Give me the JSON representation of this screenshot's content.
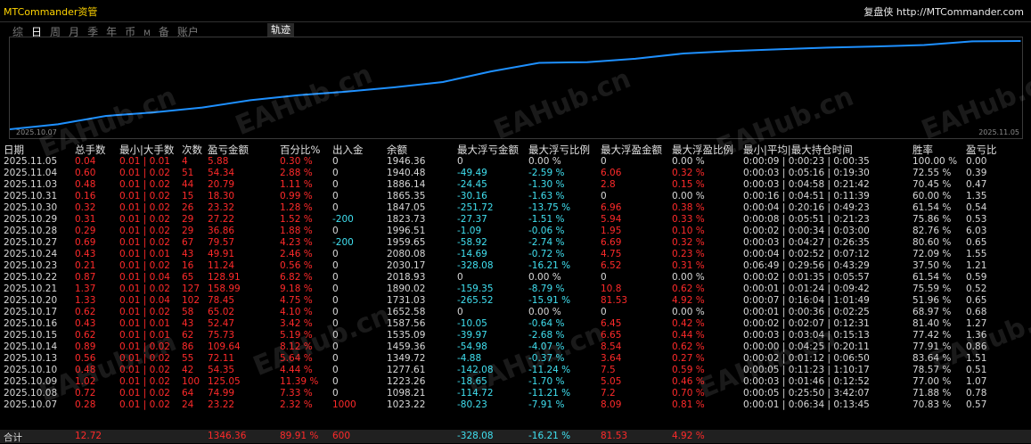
{
  "app_title": "MTCommander资管",
  "brand": "复盘侠 http://MTCommander.com",
  "tabs": [
    {
      "label": "综",
      "active": false
    },
    {
      "label": "日",
      "active": true
    },
    {
      "label": "周",
      "active": false
    },
    {
      "label": "月",
      "active": false
    },
    {
      "label": "季",
      "active": false
    },
    {
      "label": "年",
      "active": false
    },
    {
      "label": "币",
      "active": false
    },
    {
      "label": "M",
      "active": false
    },
    {
      "label": "备",
      "active": false
    },
    {
      "label": "账户",
      "active": false
    }
  ],
  "track_button": "轨迹",
  "watermark": "EAHub.cn",
  "chart_data": {
    "type": "line",
    "color": "#1e90ff",
    "x_start_label": "2025.10.07",
    "x_end_label": "2025.11.05",
    "x": [
      "2025.10.07",
      "2025.10.08",
      "2025.10.09",
      "2025.10.10",
      "2025.10.13",
      "2025.10.14",
      "2025.10.15",
      "2025.10.16",
      "2025.10.17",
      "2025.10.20",
      "2025.10.21",
      "2025.10.22",
      "2025.10.23",
      "2025.10.24",
      "2025.10.27",
      "2025.10.28",
      "2025.10.29",
      "2025.10.30",
      "2025.10.31",
      "2025.11.03",
      "2025.11.04",
      "2025.11.05"
    ],
    "y": [
      1023.22,
      1098.21,
      1223.26,
      1277.61,
      1349.72,
      1459.36,
      1535.09,
      1587.56,
      1652.58,
      1731.03,
      1890.02,
      2018.93,
      2030.17,
      2080.08,
      2159.65,
      2196.51,
      2223.71,
      2247.05,
      2265.35,
      2286.14,
      2340.48,
      2346.36
    ]
  },
  "table": {
    "headers": {
      "date": "日期",
      "lots": "总手数",
      "minmax_lots": "最小|大手数",
      "count": "次数",
      "pl": "盈亏金额",
      "pct": "百分比%",
      "inout": "出入金",
      "balance": "余额",
      "max_float_loss": "最大浮亏金额",
      "max_float_loss_pct": "最大浮亏比例",
      "max_float_profit": "最大浮盈金额",
      "max_float_profit_pct": "最大浮盈比例",
      "hold_time": "最小|平均|最大持仓时间",
      "winrate": "胜率",
      "pl_ratio": "盈亏比"
    },
    "rows": [
      {
        "date": "2025.11.05",
        "lots": "0.04",
        "minmax": "0.01 | 0.01",
        "count": "4",
        "pl": "5.88",
        "pct": "0.30 %",
        "inout": "0",
        "balance": "1946.36",
        "mfl": "0",
        "mfl_pct": "0.00 %",
        "mfp": "0",
        "mfp_pct": "0.00 %",
        "hold": "0:00:09 | 0:00:23 | 0:00:35",
        "win": "100.00 %",
        "ratio": "0.00"
      },
      {
        "date": "2025.11.04",
        "lots": "0.60",
        "minmax": "0.01 | 0.02",
        "count": "51",
        "pl": "54.34",
        "pct": "2.88 %",
        "inout": "0",
        "balance": "1940.48",
        "mfl": "-49.49",
        "mfl_pct": "-2.59 %",
        "mfp": "6.06",
        "mfp_pct": "0.32 %",
        "hold": "0:00:03 | 0:05:16 | 0:19:30",
        "win": "72.55 %",
        "ratio": "0.39"
      },
      {
        "date": "2025.11.03",
        "lots": "0.48",
        "minmax": "0.01 | 0.02",
        "count": "44",
        "pl": "20.79",
        "pct": "1.11 %",
        "inout": "0",
        "balance": "1886.14",
        "mfl": "-24.45",
        "mfl_pct": "-1.30 %",
        "mfp": "2.8",
        "mfp_pct": "0.15 %",
        "hold": "0:00:03 | 0:04:58 | 0:21:42",
        "win": "70.45 %",
        "ratio": "0.47"
      },
      {
        "date": "2025.10.31",
        "lots": "0.16",
        "minmax": "0.01 | 0.02",
        "count": "15",
        "pl": "18.30",
        "pct": "0.99 %",
        "inout": "0",
        "balance": "1865.35",
        "mfl": "-30.16",
        "mfl_pct": "-1.63 %",
        "mfp": "0",
        "mfp_pct": "0.00 %",
        "hold": "0:00:16 | 0:04:51 | 0:11:39",
        "win": "60.00 %",
        "ratio": "1.35"
      },
      {
        "date": "2025.10.30",
        "lots": "0.32",
        "minmax": "0.01 | 0.02",
        "count": "26",
        "pl": "23.32",
        "pct": "1.28 %",
        "inout": "0",
        "balance": "1847.05",
        "mfl": "-251.72",
        "mfl_pct": "-13.75 %",
        "mfp": "6.96",
        "mfp_pct": "0.38 %",
        "hold": "0:00:04 | 0:20:16 | 0:49:23",
        "win": "61.54 %",
        "ratio": "0.54"
      },
      {
        "date": "2025.10.29",
        "lots": "0.31",
        "minmax": "0.01 | 0.02",
        "count": "29",
        "pl": "27.22",
        "pct": "1.52 %",
        "inout": "-200",
        "balance": "1823.73",
        "mfl": "-27.37",
        "mfl_pct": "-1.51 %",
        "mfp": "5.94",
        "mfp_pct": "0.33 %",
        "hold": "0:00:08 | 0:05:51 | 0:21:23",
        "win": "75.86 %",
        "ratio": "0.53"
      },
      {
        "date": "2025.10.28",
        "lots": "0.29",
        "minmax": "0.01 | 0.02",
        "count": "29",
        "pl": "36.86",
        "pct": "1.88 %",
        "inout": "0",
        "balance": "1996.51",
        "mfl": "-1.09",
        "mfl_pct": "-0.06 %",
        "mfp": "1.95",
        "mfp_pct": "0.10 %",
        "hold": "0:00:02 | 0:00:34 | 0:03:00",
        "win": "82.76 %",
        "ratio": "6.03"
      },
      {
        "date": "2025.10.27",
        "lots": "0.69",
        "minmax": "0.01 | 0.02",
        "count": "67",
        "pl": "79.57",
        "pct": "4.23 %",
        "inout": "-200",
        "balance": "1959.65",
        "mfl": "-58.92",
        "mfl_pct": "-2.74 %",
        "mfp": "6.69",
        "mfp_pct": "0.32 %",
        "hold": "0:00:03 | 0:04:27 | 0:26:35",
        "win": "80.60 %",
        "ratio": "0.65"
      },
      {
        "date": "2025.10.24",
        "lots": "0.43",
        "minmax": "0.01 | 0.01",
        "count": "43",
        "pl": "49.91",
        "pct": "2.46 %",
        "inout": "0",
        "balance": "2080.08",
        "mfl": "-14.69",
        "mfl_pct": "-0.72 %",
        "mfp": "4.75",
        "mfp_pct": "0.23 %",
        "hold": "0:00:04 | 0:02:52 | 0:07:12",
        "win": "72.09 %",
        "ratio": "1.55"
      },
      {
        "date": "2025.10.23",
        "lots": "0.21",
        "minmax": "0.01 | 0.02",
        "count": "16",
        "pl": "11.24",
        "pct": "0.56 %",
        "inout": "0",
        "balance": "2030.17",
        "mfl": "-328.08",
        "mfl_pct": "-16.21 %",
        "mfp": "6.52",
        "mfp_pct": "0.31 %",
        "hold": "0:06:49 | 0:29:56 | 0:43:29",
        "win": "37.50 %",
        "ratio": "1.21"
      },
      {
        "date": "2025.10.22",
        "lots": "0.87",
        "minmax": "0.01 | 0.04",
        "count": "65",
        "pl": "128.91",
        "pct": "6.82 %",
        "inout": "0",
        "balance": "2018.93",
        "mfl": "0",
        "mfl_pct": "0.00 %",
        "mfp": "0",
        "mfp_pct": "0.00 %",
        "hold": "0:00:02 | 0:01:35 | 0:05:57",
        "win": "61.54 %",
        "ratio": "0.59"
      },
      {
        "date": "2025.10.21",
        "lots": "1.37",
        "minmax": "0.01 | 0.02",
        "count": "127",
        "pl": "158.99",
        "pct": "9.18 %",
        "inout": "0",
        "balance": "1890.02",
        "mfl": "-159.35",
        "mfl_pct": "-8.79 %",
        "mfp": "10.8",
        "mfp_pct": "0.62 %",
        "hold": "0:00:01 | 0:01:24 | 0:09:42",
        "win": "75.59 %",
        "ratio": "0.52"
      },
      {
        "date": "2025.10.20",
        "lots": "1.33",
        "minmax": "0.01 | 0.04",
        "count": "102",
        "pl": "78.45",
        "pct": "4.75 %",
        "inout": "0",
        "balance": "1731.03",
        "mfl": "-265.52",
        "mfl_pct": "-15.91 %",
        "mfp": "81.53",
        "mfp_pct": "4.92 %",
        "hold": "0:00:07 | 0:16:04 | 1:01:49",
        "win": "51.96 %",
        "ratio": "0.65"
      },
      {
        "date": "2025.10.17",
        "lots": "0.62",
        "minmax": "0.01 | 0.02",
        "count": "58",
        "pl": "65.02",
        "pct": "4.10 %",
        "inout": "0",
        "balance": "1652.58",
        "mfl": "0",
        "mfl_pct": "0.00 %",
        "mfp": "0",
        "mfp_pct": "0.00 %",
        "hold": "0:00:01 | 0:00:36 | 0:02:25",
        "win": "68.97 %",
        "ratio": "0.68"
      },
      {
        "date": "2025.10.16",
        "lots": "0.43",
        "minmax": "0.01 | 0.01",
        "count": "43",
        "pl": "52.47",
        "pct": "3.42 %",
        "inout": "0",
        "balance": "1587.56",
        "mfl": "-10.05",
        "mfl_pct": "-0.64 %",
        "mfp": "6.45",
        "mfp_pct": "0.42 %",
        "hold": "0:00:02 | 0:02:07 | 0:12:31",
        "win": "81.40 %",
        "ratio": "1.27"
      },
      {
        "date": "2025.10.15",
        "lots": "0.62",
        "minmax": "0.01 | 0.01",
        "count": "62",
        "pl": "75.73",
        "pct": "5.19 %",
        "inout": "0",
        "balance": "1535.09",
        "mfl": "-39.97",
        "mfl_pct": "-2.68 %",
        "mfp": "6.65",
        "mfp_pct": "0.44 %",
        "hold": "0:00:03 | 0:03:04 | 0:15:13",
        "win": "77.42 %",
        "ratio": "1.36"
      },
      {
        "date": "2025.10.14",
        "lots": "0.89",
        "minmax": "0.01 | 0.02",
        "count": "86",
        "pl": "109.64",
        "pct": "8.12 %",
        "inout": "0",
        "balance": "1459.36",
        "mfl": "-54.98",
        "mfl_pct": "-4.07 %",
        "mfp": "8.54",
        "mfp_pct": "0.62 %",
        "hold": "0:00:00 | 0:04:25 | 0:20:11",
        "win": "77.91 %",
        "ratio": "0.86"
      },
      {
        "date": "2025.10.13",
        "lots": "0.56",
        "minmax": "0.01 | 0.02",
        "count": "55",
        "pl": "72.11",
        "pct": "5.64 %",
        "inout": "0",
        "balance": "1349.72",
        "mfl": "-4.88",
        "mfl_pct": "-0.37 %",
        "mfp": "3.64",
        "mfp_pct": "0.27 %",
        "hold": "0:00:02 | 0:01:12 | 0:06:50",
        "win": "83.64 %",
        "ratio": "1.51"
      },
      {
        "date": "2025.10.10",
        "lots": "0.48",
        "minmax": "0.01 | 0.02",
        "count": "42",
        "pl": "54.35",
        "pct": "4.44 %",
        "inout": "0",
        "balance": "1277.61",
        "mfl": "-142.08",
        "mfl_pct": "-11.24 %",
        "mfp": "7.5",
        "mfp_pct": "0.59 %",
        "hold": "0:00:05 | 0:11:23 | 1:10:17",
        "win": "78.57 %",
        "ratio": "0.51"
      },
      {
        "date": "2025.10.09",
        "lots": "1.02",
        "minmax": "0.01 | 0.02",
        "count": "100",
        "pl": "125.05",
        "pct": "11.39 %",
        "inout": "0",
        "balance": "1223.26",
        "mfl": "-18.65",
        "mfl_pct": "-1.70 %",
        "mfp": "5.05",
        "mfp_pct": "0.46 %",
        "hold": "0:00:03 | 0:01:46 | 0:12:52",
        "win": "77.00 %",
        "ratio": "1.07"
      },
      {
        "date": "2025.10.08",
        "lots": "0.72",
        "minmax": "0.01 | 0.02",
        "count": "64",
        "pl": "74.99",
        "pct": "7.33 %",
        "inout": "0",
        "balance": "1098.21",
        "mfl": "-114.72",
        "mfl_pct": "-11.21 %",
        "mfp": "7.2",
        "mfp_pct": "0.70 %",
        "hold": "0:00:05 | 0:25:50 | 3:42:07",
        "win": "71.88 %",
        "ratio": "0.78"
      },
      {
        "date": "2025.10.07",
        "lots": "0.28",
        "minmax": "0.01 | 0.02",
        "count": "24",
        "pl": "23.22",
        "pct": "2.32 %",
        "inout": "1000",
        "balance": "1023.22",
        "mfl": "-80.23",
        "mfl_pct": "-7.91 %",
        "mfp": "8.09",
        "mfp_pct": "0.81 %",
        "hold": "0:00:01 | 0:06:34 | 0:13:45",
        "win": "70.83 %",
        "ratio": "0.57"
      }
    ],
    "total": {
      "label": "合计",
      "lots": "12.72",
      "pl": "1346.36",
      "pct": "89.91 %",
      "inout": "600",
      "mfl": "-328.08",
      "mfl_pct": "-16.21 %",
      "mfp": "81.53",
      "mfp_pct": "4.92 %"
    }
  }
}
